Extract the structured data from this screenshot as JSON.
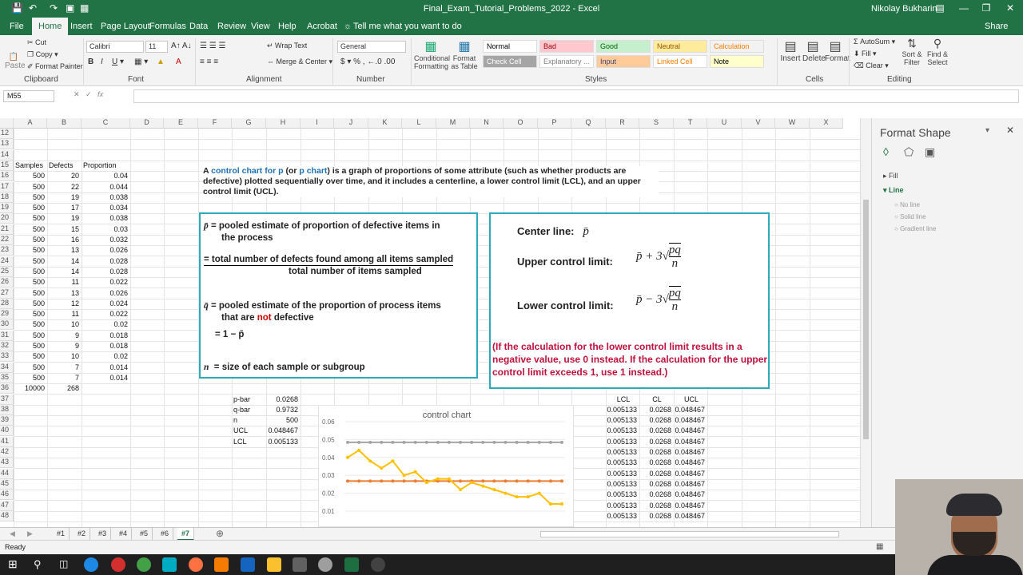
{
  "window": {
    "title": "Final_Exam_Tutorial_Problems_2022 - Excel",
    "user": "Nikolay Bukharin"
  },
  "tabs": [
    "File",
    "Home",
    "Insert",
    "Page Layout",
    "Formulas",
    "Data",
    "Review",
    "View",
    "Help",
    "Acrobat"
  ],
  "tellme": "Tell me what you want to do",
  "share": "Share",
  "ribbon": {
    "clipboard": {
      "label": "Clipboard",
      "paste": "Paste",
      "cut": "Cut",
      "copy": "Copy",
      "painter": "Format Painter"
    },
    "font": {
      "label": "Font",
      "name": "Calibri",
      "size": "11"
    },
    "alignment": {
      "label": "Alignment",
      "wrap": "Wrap Text",
      "merge": "Merge & Center"
    },
    "number": {
      "label": "Number",
      "format": "General"
    },
    "styles": {
      "label": "Styles",
      "cond": "Conditional Formatting",
      "table": "Format as Table",
      "items": [
        {
          "name": "Normal",
          "bg": "#ffffff",
          "fg": "#000000"
        },
        {
          "name": "Bad",
          "bg": "#ffc7ce",
          "fg": "#9c0006"
        },
        {
          "name": "Good",
          "bg": "#c6efce",
          "fg": "#006100"
        },
        {
          "name": "Neutral",
          "bg": "#ffeb9c",
          "fg": "#9c5700"
        },
        {
          "name": "Calculation",
          "bg": "#f2f2f2",
          "fg": "#fa7d00"
        },
        {
          "name": "Check Cell",
          "bg": "#a5a5a5",
          "fg": "#ffffff"
        },
        {
          "name": "Explanatory ...",
          "bg": "#ffffff",
          "fg": "#7f7f7f"
        },
        {
          "name": "Input",
          "bg": "#ffcc99",
          "fg": "#3f3f76"
        },
        {
          "name": "Linked Cell",
          "bg": "#ffffff",
          "fg": "#fa7d00"
        },
        {
          "name": "Note",
          "bg": "#ffffcc",
          "fg": "#000000"
        }
      ]
    },
    "cells": {
      "label": "Cells",
      "insert": "Insert",
      "delete": "Delete",
      "format": "Format"
    },
    "editing": {
      "label": "Editing",
      "autosum": "AutoSum",
      "fill": "Fill",
      "clear": "Clear",
      "sort": "Sort & Filter",
      "find": "Find & Select"
    }
  },
  "namebox": "M55",
  "fx": "fx",
  "columns": [
    "A",
    "B",
    "C",
    "D",
    "E",
    "F",
    "G",
    "H",
    "I",
    "J",
    "K",
    "L",
    "M",
    "N",
    "O",
    "P",
    "Q",
    "R",
    "S",
    "T",
    "U",
    "V",
    "W",
    "X"
  ],
  "rows": [
    "12",
    "13",
    "14",
    "15",
    "16",
    "17",
    "18",
    "19",
    "20",
    "21",
    "22",
    "23",
    "24",
    "25",
    "26",
    "27",
    "28",
    "29",
    "30",
    "31",
    "32",
    "33",
    "34",
    "35",
    "36",
    "37",
    "38",
    "39",
    "40",
    "41",
    "42",
    "43",
    "44",
    "45",
    "46",
    "47",
    "48"
  ],
  "table": {
    "headers": [
      "Samples",
      "Defects",
      "Proportion"
    ],
    "data": [
      [
        "500",
        "20",
        "0.04"
      ],
      [
        "500",
        "22",
        "0.044"
      ],
      [
        "500",
        "19",
        "0.038"
      ],
      [
        "500",
        "17",
        "0.034"
      ],
      [
        "500",
        "19",
        "0.038"
      ],
      [
        "500",
        "15",
        "0.03"
      ],
      [
        "500",
        "16",
        "0.032"
      ],
      [
        "500",
        "13",
        "0.026"
      ],
      [
        "500",
        "14",
        "0.028"
      ],
      [
        "500",
        "14",
        "0.028"
      ],
      [
        "500",
        "11",
        "0.022"
      ],
      [
        "500",
        "13",
        "0.026"
      ],
      [
        "500",
        "12",
        "0.024"
      ],
      [
        "500",
        "11",
        "0.022"
      ],
      [
        "500",
        "10",
        "0.02"
      ],
      [
        "500",
        "9",
        "0.018"
      ],
      [
        "500",
        "9",
        "0.018"
      ],
      [
        "500",
        "10",
        "0.02"
      ],
      [
        "500",
        "7",
        "0.014"
      ],
      [
        "500",
        "7",
        "0.014"
      ]
    ],
    "totals": [
      "10000",
      "268"
    ]
  },
  "stats": [
    [
      "p-bar",
      "0.0268"
    ],
    [
      "q-bar",
      "0.9732"
    ],
    [
      "n",
      "500"
    ],
    [
      "UCL",
      "0.048467"
    ],
    [
      "LCL",
      "0.005133"
    ]
  ],
  "limits": {
    "headers": [
      "LCL",
      "CL",
      "UCL"
    ],
    "row": [
      "0.005133",
      "0.0268",
      "0.048467"
    ]
  },
  "intro": {
    "a": "A ",
    "link": "control chart for p",
    "b": " (or ",
    "link2": "p chart",
    "c": ") is a graph of proportions of some attribute (such as whether products are defective) plotted sequentially over time, and it includes a centerline, a lower control limit (LCL), and an upper control limit (UCL)."
  },
  "defs": {
    "pbar1": "= pooled estimate of proportion of defective items in",
    "pbar2": "the process",
    "eq1": "= total number of defects found among all items sampled",
    "eq2": "total number of items sampled",
    "qbar1": "= pooled estimate of the proportion of process items",
    "qbar2a": "that are ",
    "not": "not",
    "qbar2b": " defective",
    "qeq": "= 1 − p̄",
    "nline": "= size of each sample or subgroup"
  },
  "limitsbox": {
    "center": "Center line:",
    "upper": "Upper control limit:",
    "lower": "Lower control limit:",
    "note": "(If the calculation for the lower control limit results in a negative value, use 0 instead.  If the calculation for the upper control limit exceeds 1, use 1 instead.)"
  },
  "panel": {
    "title": "Format Shape",
    "fill": "Fill",
    "line": "Line",
    "opts": [
      "No line",
      "Solid line",
      "Gradient line"
    ]
  },
  "sheets": [
    "#1",
    "#2",
    "#3",
    "#4",
    "#5",
    "#6",
    "#7"
  ],
  "active_sheet": "#7",
  "status": "Ready",
  "chart_data": {
    "type": "line",
    "title": "control  chart",
    "yticks": [
      "0.06",
      "0.05",
      "0.04",
      "0.03",
      "0.02",
      "0.01"
    ],
    "ylim": [
      0.01,
      0.06
    ],
    "series": [
      {
        "values": [
          0.048467,
          0.048467,
          0.048467,
          0.048467,
          0.048467,
          0.048467,
          0.048467,
          0.048467,
          0.048467,
          0.048467,
          0.048467,
          0.048467,
          0.048467,
          0.048467,
          0.048467,
          0.048467,
          0.048467,
          0.048467,
          0.048467,
          0.048467
        ],
        "color": "#a5a5a5"
      },
      {
        "values": [
          0.0268,
          0.0268,
          0.0268,
          0.0268,
          0.0268,
          0.0268,
          0.0268,
          0.0268,
          0.0268,
          0.0268,
          0.0268,
          0.0268,
          0.0268,
          0.0268,
          0.0268,
          0.0268,
          0.0268,
          0.0268,
          0.0268,
          0.0268
        ],
        "color": "#ed7d31"
      },
      {
        "values": [
          0.04,
          0.044,
          0.038,
          0.034,
          0.038,
          0.03,
          0.032,
          0.026,
          0.028,
          0.028,
          0.022,
          0.026,
          0.024,
          0.022,
          0.02,
          0.018,
          0.018,
          0.02,
          0.014,
          0.014
        ],
        "color": "#ffc000"
      }
    ]
  }
}
